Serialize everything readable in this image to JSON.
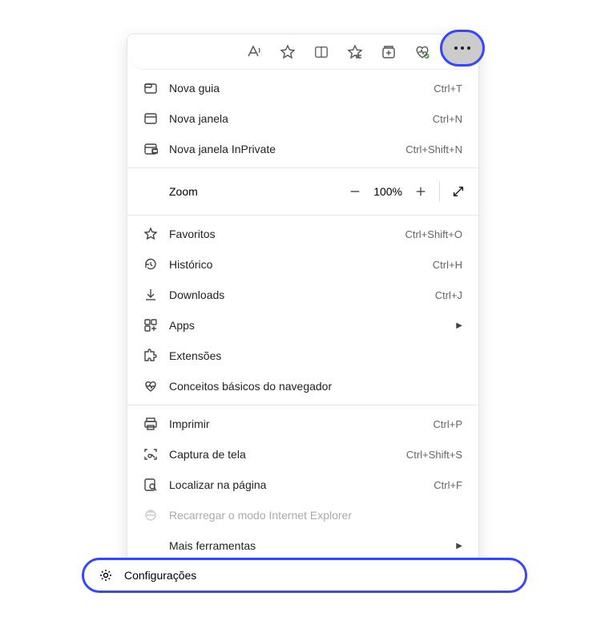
{
  "menu": {
    "new_tab": {
      "label": "Nova guia",
      "shortcut": "Ctrl+T"
    },
    "new_window": {
      "label": "Nova janela",
      "shortcut": "Ctrl+N"
    },
    "new_inprivate": {
      "label": "Nova janela InPrivate",
      "shortcut": "Ctrl+Shift+N"
    },
    "zoom": {
      "label": "Zoom",
      "value": "100%"
    },
    "favorites": {
      "label": "Favoritos",
      "shortcut": "Ctrl+Shift+O"
    },
    "history": {
      "label": "Histórico",
      "shortcut": "Ctrl+H"
    },
    "downloads": {
      "label": "Downloads",
      "shortcut": "Ctrl+J"
    },
    "apps": {
      "label": "Apps"
    },
    "extensions": {
      "label": "Extensões"
    },
    "browser_essentials": {
      "label": "Conceitos básicos do navegador"
    },
    "print": {
      "label": "Imprimir",
      "shortcut": "Ctrl+P"
    },
    "capture": {
      "label": "Captura de tela",
      "shortcut": "Ctrl+Shift+S"
    },
    "find": {
      "label": "Localizar na página",
      "shortcut": "Ctrl+F"
    },
    "ie_mode": {
      "label": "Recarregar o modo Internet Explorer"
    },
    "more_tools": {
      "label": "Mais ferramentas"
    },
    "settings": {
      "label": "Configurações"
    }
  }
}
